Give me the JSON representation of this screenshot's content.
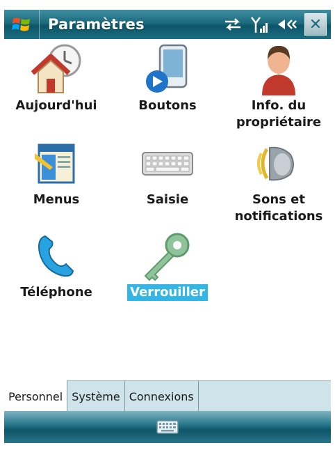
{
  "window": {
    "title": "Paramètres",
    "close_label": "✕"
  },
  "settings": [
    {
      "label": "Aujourd'hui",
      "icon": "home-clock-icon"
    },
    {
      "label": "Boutons",
      "icon": "phone-buttons-icon"
    },
    {
      "label": "Info. du propriétaire",
      "icon": "owner-person-icon"
    },
    {
      "label": "Menus",
      "icon": "menus-icon"
    },
    {
      "label": "Saisie",
      "icon": "keyboard-icon"
    },
    {
      "label": "Sons et notifications",
      "icon": "speaker-icon"
    },
    {
      "label": "Téléphone",
      "icon": "telephone-handset-icon"
    },
    {
      "label": "Verrouiller",
      "icon": "key-icon",
      "selected": true
    }
  ],
  "tabs": [
    {
      "label": "Personnel",
      "active": true
    },
    {
      "label": "Système"
    },
    {
      "label": "Connexions"
    }
  ],
  "colors": {
    "titlebar": "#1d6a7e",
    "selection": "#33b5e5",
    "tabstrip": "#cfe3ea"
  }
}
